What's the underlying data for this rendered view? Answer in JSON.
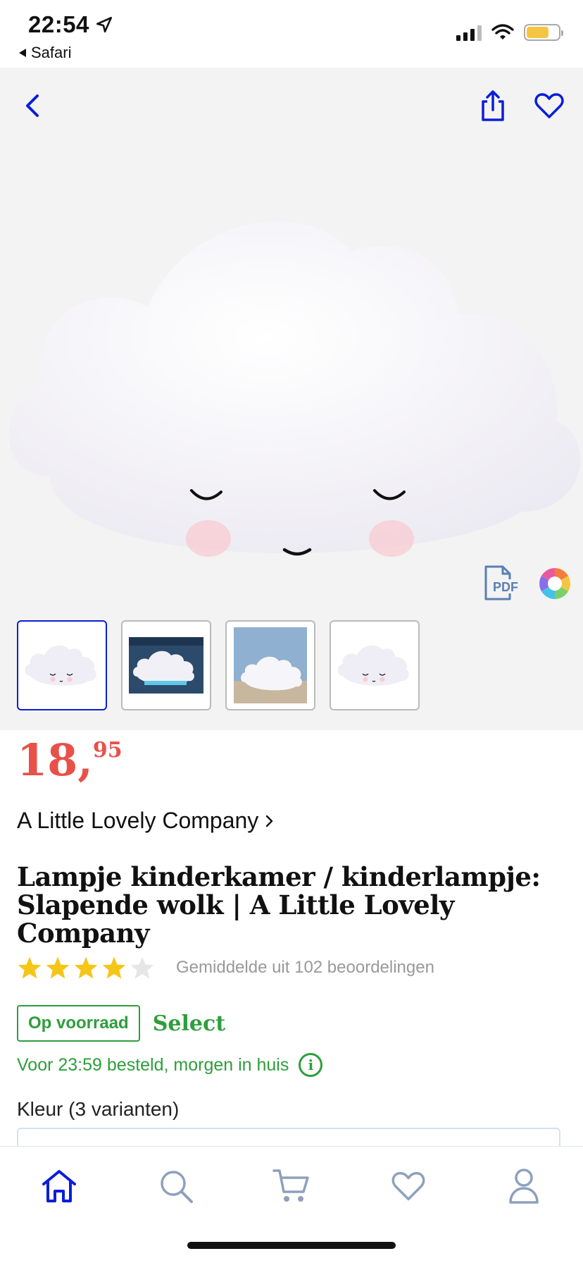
{
  "status": {
    "time": "22:54",
    "back_app": "Safari",
    "battery_color": "#f5c542"
  },
  "hero": {
    "icons": [
      "back-chevron-icon",
      "share-icon",
      "heart-icon",
      "pdf-icon",
      "color-wheel-icon"
    ],
    "pdf_label": "PDF",
    "thumbnails": [
      {
        "name": "cloud-front",
        "active": true
      },
      {
        "name": "cloud-in-box",
        "active": false
      },
      {
        "name": "cloud-on-table",
        "active": false
      },
      {
        "name": "cloud-front-small",
        "active": false
      }
    ]
  },
  "product": {
    "price_int": "18,",
    "price_dec": "95",
    "brand": "A Little Lovely Company",
    "title": "Lampje kinderkamer / kinderlampje: Slapende wolk | A Little Lovely Company",
    "rating_value": 4,
    "rating_max": 5,
    "rating_text": "Gemiddelde uit 102 beoordelingen",
    "stock_label": "Op voorraad",
    "select_label": "Select",
    "delivery_text": "Voor 23:59 besteld, morgen in huis",
    "info_glyph": "i",
    "color_label": "Kleur (3 varianten)"
  },
  "colors": {
    "accent": "#0a1ed8",
    "price": "#e8514a",
    "green": "#2e9e3c",
    "star": "#f5c518"
  },
  "tabbar": {
    "tabs": [
      "home-icon",
      "search-icon",
      "cart-icon",
      "heart-icon",
      "account-icon"
    ],
    "active": "home-icon"
  }
}
